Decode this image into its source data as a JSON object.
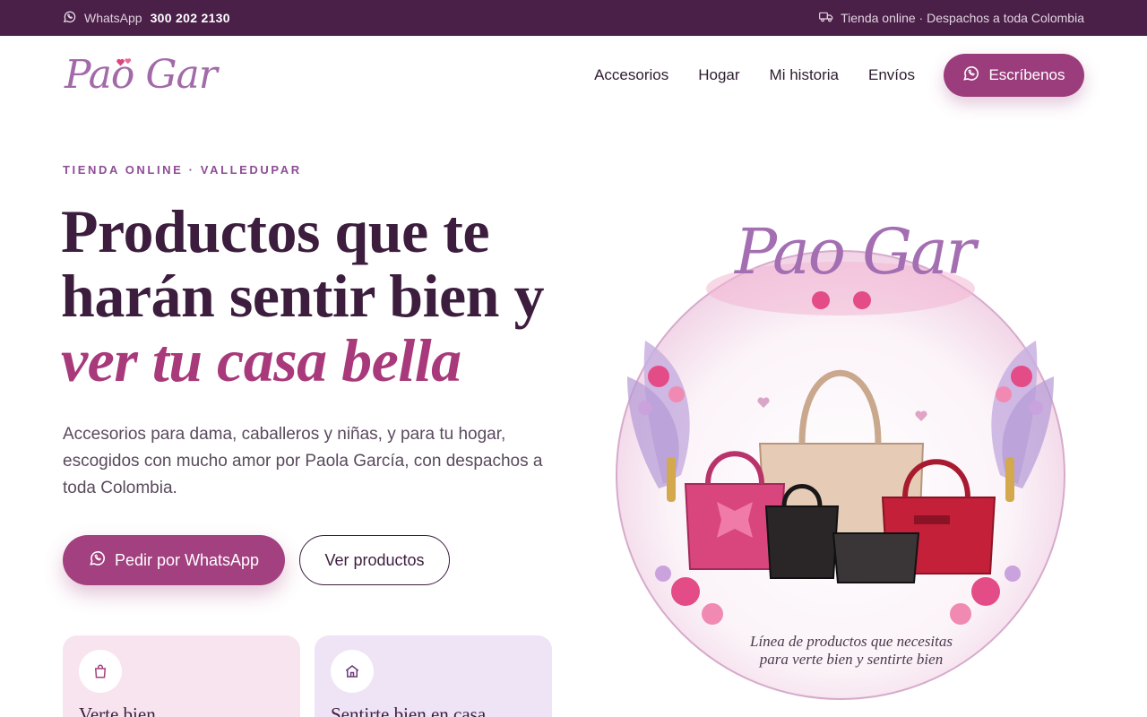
{
  "topbar": {
    "whatsapp_label": "WhatsApp",
    "whatsapp_number": "300 202 2130",
    "shipping_text": "Tienda online · Despachos a toda Colombia"
  },
  "header": {
    "logo_text": "Pao Gar",
    "nav": [
      "Accesorios",
      "Hogar",
      "Mi historia",
      "Envíos"
    ],
    "cta_label": "Escríbenos"
  },
  "hero": {
    "eyebrow": "TIENDA ONLINE · VALLEDUPAR",
    "title_line1": "Productos que te",
    "title_line2": "harán sentir bien y",
    "title_accent": "ver tu casa bella",
    "subtitle": "Accesorios para dama, caballeros y niñas, y para tu hogar, escogidos con mucho amor por Paola García, con despachos a toda Colombia.",
    "primary_button": "Pedir por WhatsApp",
    "secondary_button": "Ver productos"
  },
  "cards": [
    {
      "title": "Verte bien",
      "icon": "shopping-bag-icon"
    },
    {
      "title": "Sentirte bien en casa",
      "icon": "home-icon"
    }
  ],
  "illustration": {
    "brand_text": "Pao Gar",
    "tagline_line1": "Línea de productos que necesitas",
    "tagline_line2": "para verte bien y sentirte bien"
  },
  "colors": {
    "topbar_bg": "#4a1f48",
    "primary": "#a3407f",
    "title": "#3c1d3e",
    "accent": "#a8397a",
    "eyebrow": "#8e4d96"
  }
}
